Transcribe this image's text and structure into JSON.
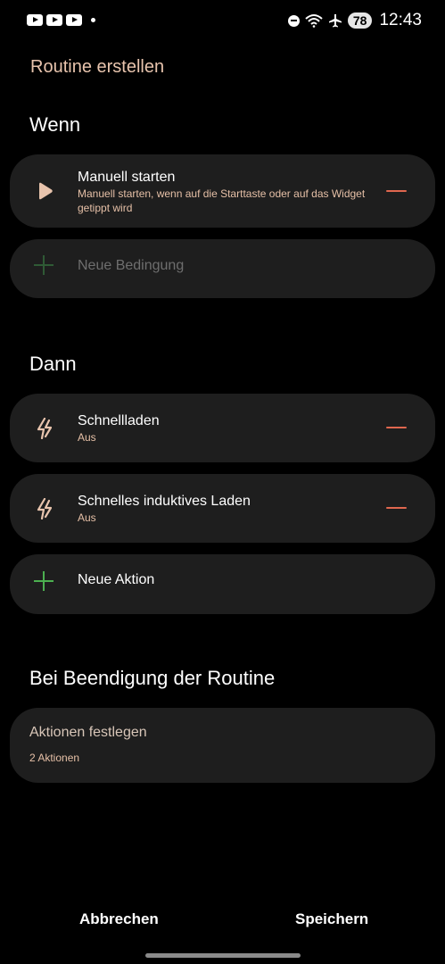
{
  "status_bar": {
    "time": "12:43",
    "battery": "78",
    "left_icons": [
      "youtube-icon",
      "youtube-icon",
      "youtube-icon",
      "dot"
    ],
    "right_icons": [
      "do-not-disturb-icon",
      "wifi-icon",
      "airplane-icon"
    ]
  },
  "header": {
    "title": "Routine erstellen"
  },
  "when": {
    "title": "Wenn",
    "condition": {
      "icon": "play-icon",
      "title": "Manuell starten",
      "subtitle": "Manuell starten, wenn auf die Starttaste oder auf das Widget getippt wird"
    },
    "add_label": "Neue Bedingung"
  },
  "then": {
    "title": "Dann",
    "actions": [
      {
        "icon": "fast-charge-icon",
        "title": "Schnellladen",
        "subtitle": "Aus"
      },
      {
        "icon": "fast-charge-icon",
        "title": "Schnelles induktives Laden",
        "subtitle": "Aus"
      }
    ],
    "add_label": "Neue Aktion"
  },
  "end": {
    "title": "Bei Beendigung der Routine",
    "card_title": "Aktionen festlegen",
    "card_subtitle": "2 Aktionen"
  },
  "footer": {
    "cancel": "Abbrechen",
    "save": "Speichern"
  },
  "colors": {
    "accent": "#e8c4ad",
    "remove": "#e0674f",
    "add_active": "#4caf50",
    "add_disabled": "#2f5a35",
    "card": "#1e1e1e"
  }
}
